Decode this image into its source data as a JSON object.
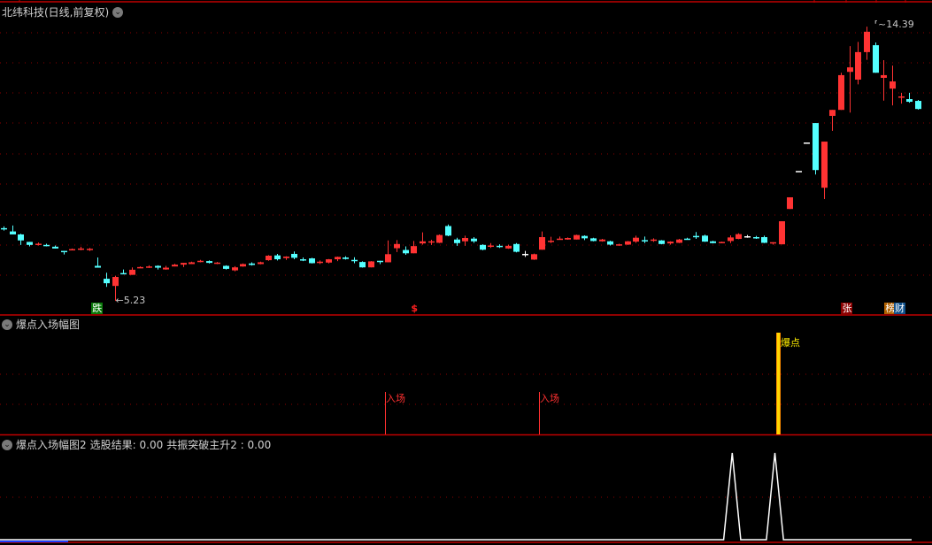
{
  "main_panel": {
    "title": "北纬科技(日线,前复权)",
    "high_label": "14.39",
    "low_label": "5.23"
  },
  "markers": {
    "die": "跌",
    "dollar": "$",
    "zhang": "张",
    "bang": "榜",
    "cai": "财"
  },
  "panel2": {
    "title": "爆点入场幅图",
    "entry_label": "入场",
    "burst_label": "爆点"
  },
  "panel3": {
    "title": "爆点入场幅图2",
    "result_label": "选股结果: 0.00",
    "resonance_label": "共振突破主升2 : 0.00"
  },
  "colors": {
    "up": "#ff3333",
    "down": "#54ffff",
    "flat": "#ffffff",
    "grid": "#8b0000",
    "border": "#c00000",
    "burst": "#ffd700"
  },
  "chart_data": [
    {
      "type": "candlestick",
      "title": "北纬科技(日线,前复权)",
      "ylim": [
        4.76,
        15.28
      ],
      "fields": [
        "open",
        "close",
        "high",
        "low"
      ],
      "candles": [
        [
          7.66,
          7.65,
          7.72,
          7.58
        ],
        [
          7.55,
          7.45,
          7.75,
          7.45
        ],
        [
          7.45,
          7.25,
          7.47,
          7.1
        ],
        [
          7.2,
          7.1,
          7.2,
          7.05
        ],
        [
          7.1,
          7.14,
          7.18,
          7.08
        ],
        [
          7.1,
          7.08,
          7.14,
          7.05
        ],
        [
          7.04,
          6.98,
          7.08,
          6.98
        ],
        [
          6.9,
          6.88,
          6.9,
          6.78
        ],
        [
          6.94,
          6.96,
          6.98,
          6.94
        ],
        [
          6.96,
          6.98,
          7.04,
          6.92
        ],
        [
          6.95,
          6.97,
          7.0,
          6.9
        ],
        [
          6.4,
          6.34,
          6.68,
          6.34
        ],
        [
          5.97,
          5.82,
          6.17,
          5.7
        ],
        [
          5.73,
          6.03,
          6.07,
          5.23
        ],
        [
          6.16,
          6.14,
          6.28,
          6.13
        ],
        [
          6.1,
          6.27,
          6.35,
          6.1
        ],
        [
          6.34,
          6.36,
          6.38,
          6.34
        ],
        [
          6.36,
          6.38,
          6.42,
          6.33
        ],
        [
          6.4,
          6.34,
          6.42,
          6.28
        ],
        [
          6.28,
          6.34,
          6.4,
          6.27
        ],
        [
          6.38,
          6.44,
          6.47,
          6.38
        ],
        [
          6.44,
          6.5,
          6.5,
          6.36
        ],
        [
          6.46,
          6.52,
          6.54,
          6.46
        ],
        [
          6.53,
          6.57,
          6.6,
          6.52
        ],
        [
          6.56,
          6.5,
          6.58,
          6.48
        ],
        [
          6.48,
          6.51,
          6.53,
          6.46
        ],
        [
          6.4,
          6.3,
          6.42,
          6.28
        ],
        [
          6.25,
          6.35,
          6.39,
          6.22
        ],
        [
          6.38,
          6.46,
          6.48,
          6.37
        ],
        [
          6.48,
          6.43,
          6.52,
          6.41
        ],
        [
          6.46,
          6.52,
          6.54,
          6.45
        ],
        [
          6.59,
          6.74,
          6.76,
          6.57
        ],
        [
          6.75,
          6.62,
          6.8,
          6.58
        ],
        [
          6.66,
          6.71,
          6.72,
          6.6
        ],
        [
          6.8,
          6.67,
          6.88,
          6.62
        ],
        [
          6.62,
          6.6,
          6.68,
          6.56
        ],
        [
          6.65,
          6.49,
          6.67,
          6.48
        ],
        [
          6.52,
          6.54,
          6.58,
          6.46
        ],
        [
          6.51,
          6.62,
          6.63,
          6.48
        ],
        [
          6.62,
          6.7,
          6.71,
          6.56
        ],
        [
          6.68,
          6.63,
          6.72,
          6.61
        ],
        [
          6.6,
          6.58,
          6.69,
          6.49
        ],
        [
          6.53,
          6.35,
          6.55,
          6.34
        ],
        [
          6.35,
          6.55,
          6.56,
          6.35
        ],
        [
          6.57,
          6.55,
          6.57,
          6.46
        ],
        [
          6.52,
          6.79,
          7.25,
          6.52
        ],
        [
          6.99,
          7.13,
          7.26,
          6.86
        ],
        [
          6.93,
          6.82,
          7.05,
          6.77
        ],
        [
          6.82,
          7.06,
          7.23,
          6.82
        ],
        [
          7.15,
          7.22,
          7.52,
          7.11
        ],
        [
          7.2,
          7.22,
          7.27,
          7.1
        ],
        [
          7.17,
          7.43,
          7.45,
          7.16
        ],
        [
          7.73,
          7.41,
          7.78,
          7.39
        ],
        [
          7.28,
          7.16,
          7.34,
          7.07
        ],
        [
          7.22,
          7.33,
          7.41,
          7.07
        ],
        [
          7.31,
          7.22,
          7.36,
          7.17
        ],
        [
          7.1,
          6.94,
          7.12,
          6.92
        ],
        [
          7.06,
          7.08,
          7.16,
          7.0
        ],
        [
          7.07,
          7.03,
          7.12,
          7.0
        ],
        [
          6.98,
          7.07,
          7.11,
          6.97
        ],
        [
          7.13,
          6.87,
          7.16,
          6.85
        ],
        [
          6.8,
          6.8,
          6.9,
          6.7
        ],
        [
          6.61,
          6.79,
          6.81,
          6.6
        ],
        [
          6.94,
          7.36,
          7.55,
          6.94
        ],
        [
          7.22,
          7.24,
          7.37,
          7.16
        ],
        [
          7.27,
          7.31,
          7.38,
          7.27
        ],
        [
          7.28,
          7.33,
          7.35,
          7.27
        ],
        [
          7.28,
          7.43,
          7.44,
          7.28
        ],
        [
          7.4,
          7.32,
          7.42,
          7.26
        ],
        [
          7.32,
          7.23,
          7.34,
          7.22
        ],
        [
          7.22,
          7.28,
          7.3,
          7.21
        ],
        [
          7.22,
          7.11,
          7.24,
          7.08
        ],
        [
          7.1,
          7.12,
          7.14,
          7.07
        ],
        [
          7.11,
          7.22,
          7.23,
          7.1
        ],
        [
          7.21,
          7.34,
          7.41,
          7.17
        ],
        [
          7.26,
          7.24,
          7.38,
          7.16
        ],
        [
          7.26,
          7.28,
          7.32,
          7.2
        ],
        [
          7.25,
          7.13,
          7.26,
          7.12
        ],
        [
          7.15,
          7.21,
          7.22,
          7.11
        ],
        [
          7.17,
          7.28,
          7.3,
          7.16
        ],
        [
          7.31,
          7.3,
          7.34,
          7.28
        ],
        [
          7.4,
          7.39,
          7.53,
          7.3
        ],
        [
          7.41,
          7.21,
          7.44,
          7.2
        ],
        [
          7.22,
          7.16,
          7.24,
          7.15
        ],
        [
          7.18,
          7.2,
          7.21,
          7.17
        ],
        [
          7.23,
          7.35,
          7.42,
          7.16
        ],
        [
          7.3,
          7.46,
          7.49,
          7.29
        ],
        [
          7.39,
          7.39,
          7.43,
          7.34
        ],
        [
          7.36,
          7.34,
          7.4,
          7.3
        ],
        [
          7.36,
          7.17,
          7.41,
          7.16
        ],
        [
          7.15,
          7.19,
          7.19,
          7.11
        ],
        [
          7.12,
          7.89,
          7.89,
          7.12
        ],
        [
          8.3,
          8.69,
          8.69,
          8.3
        ],
        [
          9.57,
          9.57,
          9.57,
          9.57
        ],
        [
          10.52,
          10.52,
          10.52,
          10.52
        ],
        [
          11.17,
          9.6,
          11.17,
          9.45
        ],
        [
          9.01,
          10.55,
          10.55,
          8.63
        ],
        [
          11.41,
          11.61,
          11.61,
          10.91
        ],
        [
          11.61,
          12.77,
          12.85,
          11.61
        ],
        [
          12.88,
          13.03,
          13.74,
          11.52
        ],
        [
          12.62,
          13.54,
          13.88,
          12.46
        ],
        [
          13.54,
          14.22,
          14.39,
          13.28
        ],
        [
          13.77,
          12.85,
          13.86,
          12.85
        ],
        [
          12.68,
          12.77,
          13.27,
          11.92
        ],
        [
          12.32,
          12.56,
          13.09,
          11.76
        ],
        [
          12.03,
          12.06,
          12.18,
          11.82
        ],
        [
          11.97,
          11.88,
          12.18,
          11.85
        ],
        [
          11.91,
          11.64,
          11.94,
          11.62
        ]
      ],
      "high": {
        "index": 102,
        "value": 14.39
      },
      "low": {
        "index": 13,
        "value": 5.23
      },
      "marker_indices": {
        "die": 11,
        "dollar": 48,
        "zhang": 97,
        "bang": 103,
        "cai": 104
      }
    },
    {
      "type": "signal",
      "title": "爆点入场幅图",
      "entry_indices": [
        45,
        63
      ],
      "burst_index": 91
    },
    {
      "type": "line",
      "title": "爆点入场幅图2",
      "ylim": [
        0,
        1
      ],
      "spikes": [
        86,
        91
      ],
      "series_length": 108,
      "values": {
        "选股结果": 0.0,
        "共振突破主升2": 0.0
      }
    }
  ]
}
